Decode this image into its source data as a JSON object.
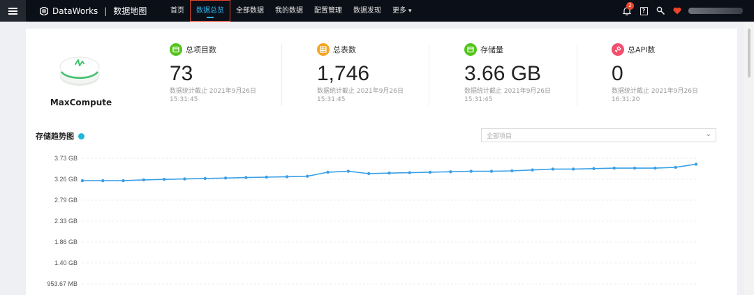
{
  "topbar": {
    "brand": "DataWorks",
    "separator": "|",
    "module": "数据地图",
    "nav": [
      {
        "label": "首页",
        "active": false
      },
      {
        "label": "数据总览",
        "active": true
      },
      {
        "label": "全部数据",
        "active": false
      },
      {
        "label": "我的数据",
        "active": false
      },
      {
        "label": "配置管理",
        "active": false
      },
      {
        "label": "数据发现",
        "active": false
      },
      {
        "label": "更多",
        "active": false,
        "dropdown": true
      }
    ],
    "notification_count": "2",
    "help_icon_text": "?",
    "icons": [
      "menu-icon",
      "dataworks-logo-icon",
      "bell-icon",
      "help-icon",
      "wrench-icon",
      "heart-icon"
    ]
  },
  "engine": {
    "name": "MaxCompute"
  },
  "stats": [
    {
      "label": "总项目数",
      "value": "73",
      "note": "数据统计截止 2021年9月26日 15:31:45",
      "icon": "project-icon",
      "color": "#52c41a"
    },
    {
      "label": "总表数",
      "value": "1,746",
      "note": "数据统计截止 2021年9月26日 15:31:45",
      "icon": "table-icon",
      "color": "#f5a623"
    },
    {
      "label": "存储量",
      "value": "3.66 GB",
      "note": "数据统计截止 2021年9月26日 15:31:45",
      "icon": "storage-icon",
      "color": "#52c41a"
    },
    {
      "label": "总API数",
      "value": "0",
      "note": "数据统计截止 2021年9月26日 16:31:20",
      "icon": "api-icon",
      "color": "#f0506e"
    }
  ],
  "trend": {
    "title": "存储趋势图",
    "select_placeholder": "全部项目"
  },
  "chart_data": {
    "type": "line",
    "title": "存储趋势图",
    "ylabel": "",
    "xlabel": "",
    "y_unit": "GB",
    "y_tick_labels": [
      "3.73 GB",
      "3.26 GB",
      "2.79 GB",
      "2.33 GB",
      "1.86 GB",
      "1.40 GB",
      "953.67 MB"
    ],
    "y_tick_values": [
      3.73,
      3.26,
      2.79,
      2.33,
      1.86,
      1.4,
      0.93
    ],
    "x": [],
    "series": [
      {
        "values": [
          3.23,
          3.23,
          3.23,
          3.25,
          3.26,
          3.27,
          3.28,
          3.29,
          3.3,
          3.31,
          3.32,
          3.33,
          3.42,
          3.44,
          3.39,
          3.4,
          3.41,
          3.42,
          3.43,
          3.44,
          3.44,
          3.45,
          3.47,
          3.49,
          3.49,
          3.5,
          3.51,
          3.51,
          3.51,
          3.53,
          3.6
        ],
        "color": "#3aa0e6"
      }
    ],
    "grid": true,
    "legend": "none"
  }
}
